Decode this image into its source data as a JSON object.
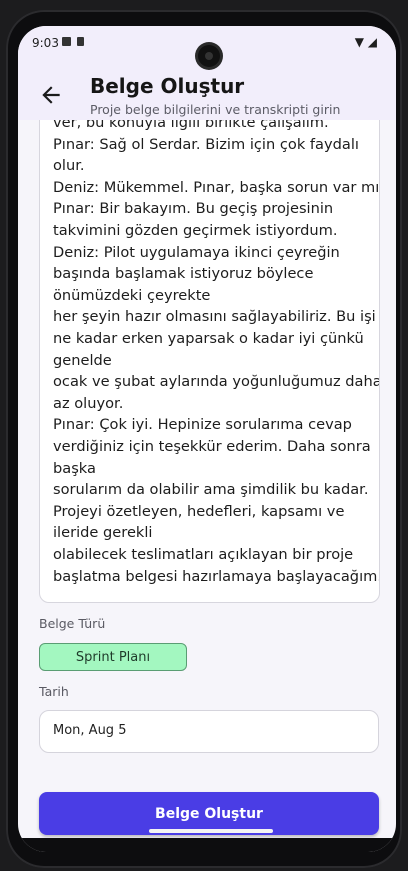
{
  "status_bar": {
    "time": "9:03"
  },
  "header": {
    "title": "Belge Oluştur",
    "subtitle": "Proje belge bilgilerini ve transkripti girin"
  },
  "transcript": {
    "lines": [
      "ver, bu konuyla ilgili birlikte çalışalım.",
      "Pınar: Sağ ol Serdar. Bizim için çok faydalı",
      "olur.",
      "Deniz: Mükemmel. Pınar, başka sorun var mı?",
      "Pınar: Bir bakayım. Bu geçiş projesinin",
      "takvimini gözden geçirmek istiyordum.",
      "Deniz: Pilot uygulamaya ikinci çeyreğin",
      "başında başlamak istiyoruz böylece",
      "önümüzdeki çeyrekte",
      "her şeyin hazır olmasını sağlayabiliriz. Bu işi",
      "ne kadar erken yaparsak o kadar iyi çünkü",
      "genelde",
      "ocak ve şubat aylarında yoğunluğumuz daha",
      "az oluyor.",
      "Pınar: Çok iyi. Hepinize sorularıma cevap",
      "verdiğiniz için teşekkür ederim. Daha sonra",
      "başka",
      "sorularım da olabilir ama şimdilik bu kadar.",
      "Projeyi özetleyen, hedefleri, kapsamı ve",
      "ileride gerekli",
      "olabilecek teslimatları açıklayan bir proje",
      "başlatma belgesi hazırlamaya başlayacağım."
    ]
  },
  "form": {
    "doc_type_label": "Belge Türü",
    "doc_type_value": "Sprint Planı",
    "date_label": "Tarih",
    "date_value": "Mon, Aug 5",
    "submit_label": "Belge Oluştur"
  },
  "colors": {
    "accent": "#4a3de5",
    "chip_bg": "#a3f7c0",
    "header_bg": "#f2eefb"
  },
  "icons": [
    "back-arrow-icon",
    "wifi-icon",
    "signal-icon"
  ]
}
